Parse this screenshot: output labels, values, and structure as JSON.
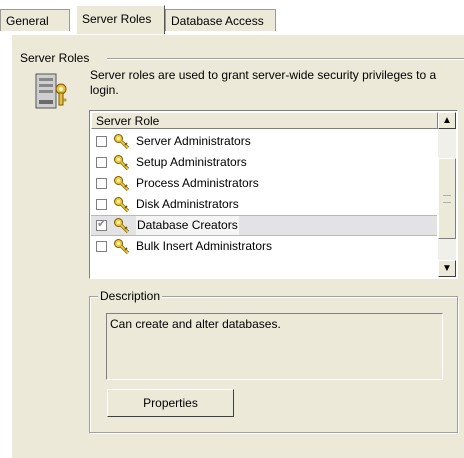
{
  "tabs": [
    "General",
    "Server Roles",
    "Database Access"
  ],
  "group_label": "Server Roles",
  "intro_text": "Server roles are used to grant server-wide security privileges to a login.",
  "list": {
    "header": "Server Role",
    "rows": [
      {
        "label": "Server Administrators",
        "checked": false
      },
      {
        "label": "Setup Administrators",
        "checked": false
      },
      {
        "label": "Process Administrators",
        "checked": false
      },
      {
        "label": "Disk Administrators",
        "checked": false
      },
      {
        "label": "Database Creators",
        "checked": true,
        "selected": true
      },
      {
        "label": "Bulk Insert Administrators",
        "checked": false
      }
    ]
  },
  "description": {
    "legend": "Description",
    "text": "Can create and alter databases."
  },
  "buttons": {
    "properties": "Properties"
  },
  "icons": {
    "role": "server-key-icon",
    "row": "key-icon",
    "scroll_up": "chevron-up-icon",
    "scroll_down": "chevron-down-icon"
  }
}
